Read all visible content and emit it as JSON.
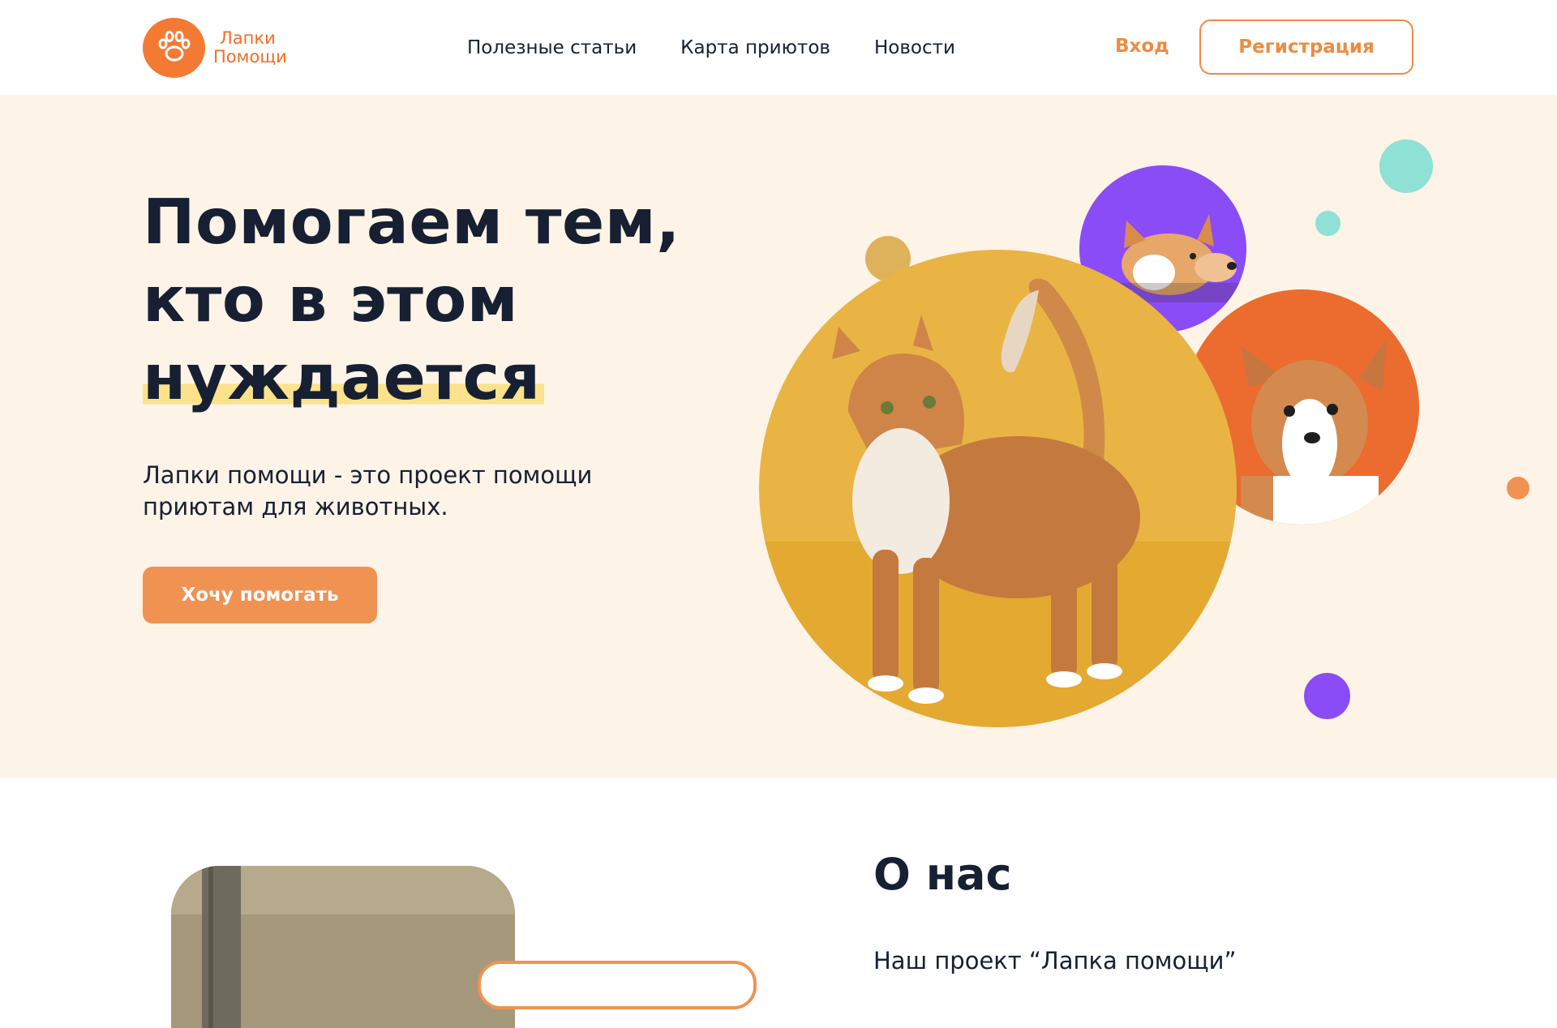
{
  "header": {
    "logo": {
      "line1": "Лапки",
      "line2": "Помощи",
      "icon": "paw-icon"
    },
    "nav": [
      {
        "label": "Полезные статьи"
      },
      {
        "label": "Карта приютов"
      },
      {
        "label": "Новости"
      }
    ],
    "login_label": "Вход",
    "register_label": "Регистрация"
  },
  "hero": {
    "title_line1": "Помогаем тем,",
    "title_line2": "кто в этом",
    "title_line3": "нуждается",
    "subtitle": "Лапки помощи - это проект помощи приютам для животных.",
    "cta_label": "Хочу помогать",
    "images": [
      {
        "subject": "cat",
        "icon": "cat-photo"
      },
      {
        "subject": "corgi",
        "icon": "corgi-photo"
      },
      {
        "subject": "puppy",
        "icon": "puppy-photo"
      }
    ]
  },
  "about": {
    "title": "О нас",
    "text": "Наш проект “Лапка помощи”"
  },
  "colors": {
    "accent": "#f47a33",
    "button": "#f09252",
    "hero_bg": "#fdf3e7",
    "text": "#172033",
    "highlight": "#fbe28b",
    "purple": "#8a4cf7",
    "teal": "#8fe0d5",
    "mustard": "#ddb25a",
    "cat_bg": "#e9b443",
    "puppy_bg": "#ec6b2f"
  }
}
